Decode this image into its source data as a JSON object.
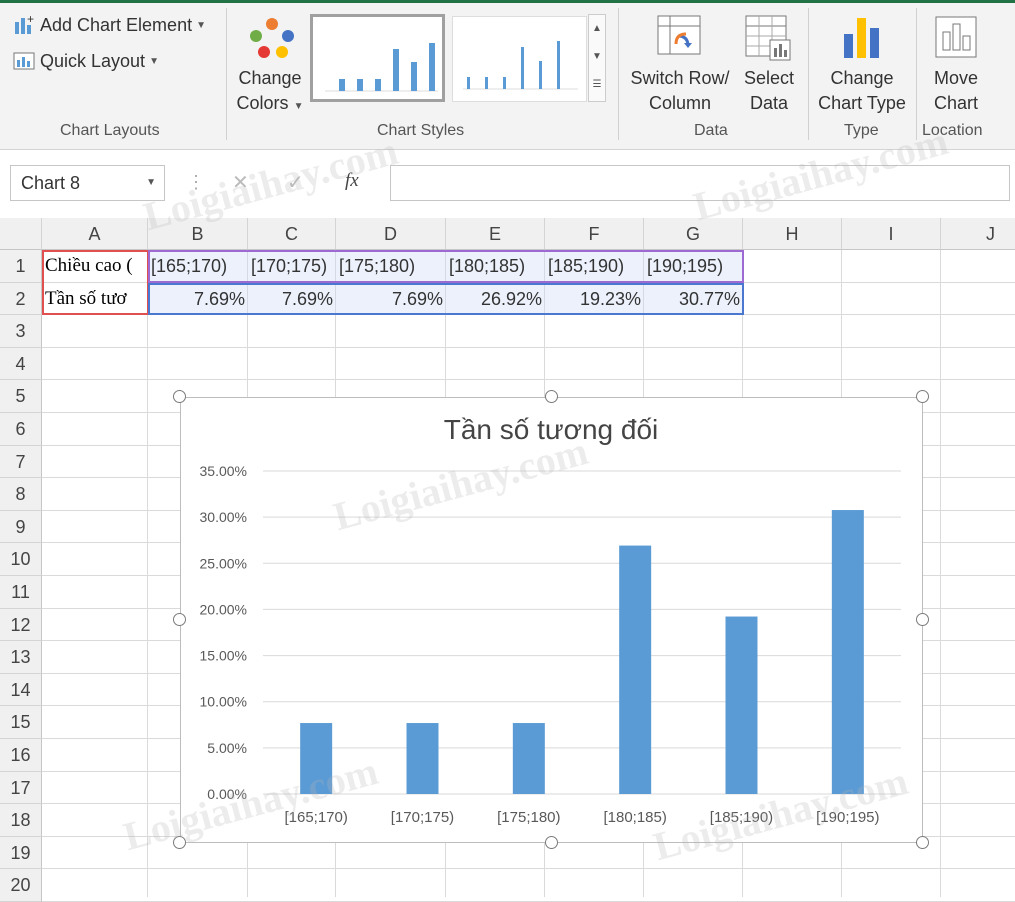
{
  "ribbon": {
    "add_chart_element": "Add Chart Element",
    "quick_layout": "Quick Layout",
    "chart_layouts_label": "Chart Layouts",
    "change_colors_l1": "Change",
    "change_colors_l2": "Colors",
    "chart_styles_label": "Chart Styles",
    "switch_row_l1": "Switch Row/",
    "switch_row_l2": "Column",
    "select_data_l1": "Select",
    "select_data_l2": "Data",
    "data_label": "Data",
    "change_type_l1": "Change",
    "change_type_l2": "Chart Type",
    "type_label": "Type",
    "move_chart_l1": "Move",
    "move_chart_l2": "Chart",
    "location_label": "Location"
  },
  "formula_bar": {
    "name_box": "Chart 8",
    "fx": "fx",
    "formula": ""
  },
  "sheet": {
    "columns": [
      "A",
      "B",
      "C",
      "D",
      "E",
      "F",
      "G",
      "H",
      "I",
      "J"
    ],
    "rows": [
      "1",
      "2",
      "3",
      "4",
      "5",
      "6",
      "7",
      "8",
      "9",
      "10",
      "11",
      "12",
      "13",
      "14",
      "15",
      "16",
      "17",
      "18",
      "19",
      "20"
    ],
    "row1": [
      "Chiều cao (",
      "[165;170)",
      "[170;175)",
      "[175;180)",
      "[180;185)",
      "[185;190)",
      "[190;195)"
    ],
    "row2": [
      "Tần số tươ",
      "7.69%",
      "7.69%",
      "7.69%",
      "26.92%",
      "19.23%",
      "30.77%"
    ]
  },
  "chart_data": {
    "type": "bar",
    "title": "Tần số tương đối",
    "categories": [
      "[165;170)",
      "[170;175)",
      "[175;180)",
      "[180;185)",
      "[185;190)",
      "[190;195)"
    ],
    "values": [
      7.69,
      7.69,
      7.69,
      26.92,
      19.23,
      30.77
    ],
    "ylim": [
      0,
      35
    ],
    "yticks": [
      "0.00%",
      "5.00%",
      "10.00%",
      "15.00%",
      "20.00%",
      "25.00%",
      "30.00%",
      "35.00%"
    ],
    "grid": true,
    "bar_color": "#5b9bd5"
  },
  "colors": {
    "accent": "#217346",
    "bar": "#5b9bd5"
  },
  "watermark": "Loigiaihay.com"
}
